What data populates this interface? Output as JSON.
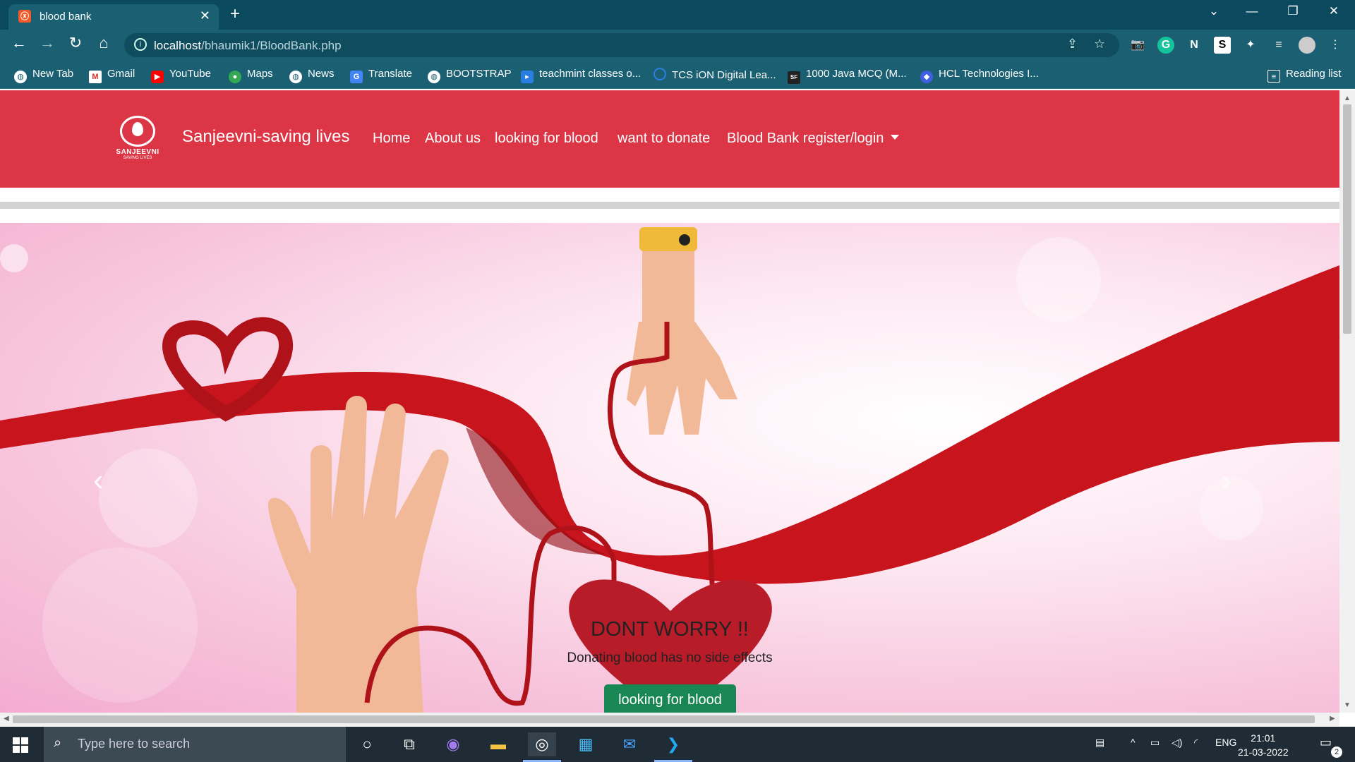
{
  "browser": {
    "tab_title": "blood bank",
    "url_host": "localhost",
    "url_path": "/bhaumik1/BloodBank.php",
    "new_tab": "+",
    "bookmarks": [
      {
        "label": "New Tab",
        "icon": "globe-icon"
      },
      {
        "label": "Gmail",
        "icon": "gmail-icon"
      },
      {
        "label": "YouTube",
        "icon": "youtube-icon"
      },
      {
        "label": "Maps",
        "icon": "maps-icon"
      },
      {
        "label": "News",
        "icon": "globe-icon"
      },
      {
        "label": "Translate",
        "icon": "translate-icon"
      },
      {
        "label": "BOOTSTRAP",
        "icon": "globe-icon"
      },
      {
        "label": "teachmint classes o...",
        "icon": "teachmint-icon"
      },
      {
        "label": "TCS iON Digital Lea...",
        "icon": "tcs-icon"
      },
      {
        "label": "1000 Java MCQ (M...",
        "icon": "book-icon"
      },
      {
        "label": "HCL Technologies I...",
        "icon": "hcl-icon"
      }
    ],
    "reading_list": "Reading list"
  },
  "site": {
    "logo_line1": "SANJEEVNI",
    "logo_line2": "SAVING LIVES",
    "brand": "Sanjeevni-saving lives",
    "nav": [
      "Home",
      "About us",
      "looking for blood",
      "want to donate",
      "Blood Bank register/login"
    ],
    "carousel": {
      "title": "DONT WORRY !!",
      "subtitle": "Donating blood has no side effects",
      "button": "looking for blood"
    }
  },
  "taskbar": {
    "search_placeholder": "Type here to search",
    "lang": "ENG",
    "time": "21:01",
    "date": "21-03-2022",
    "notifications": "2"
  },
  "colors": {
    "nav_red": "#dc3545",
    "chrome_teal": "#1b6072",
    "btn_green": "#198754",
    "ribbon_red": "#c8141c"
  }
}
